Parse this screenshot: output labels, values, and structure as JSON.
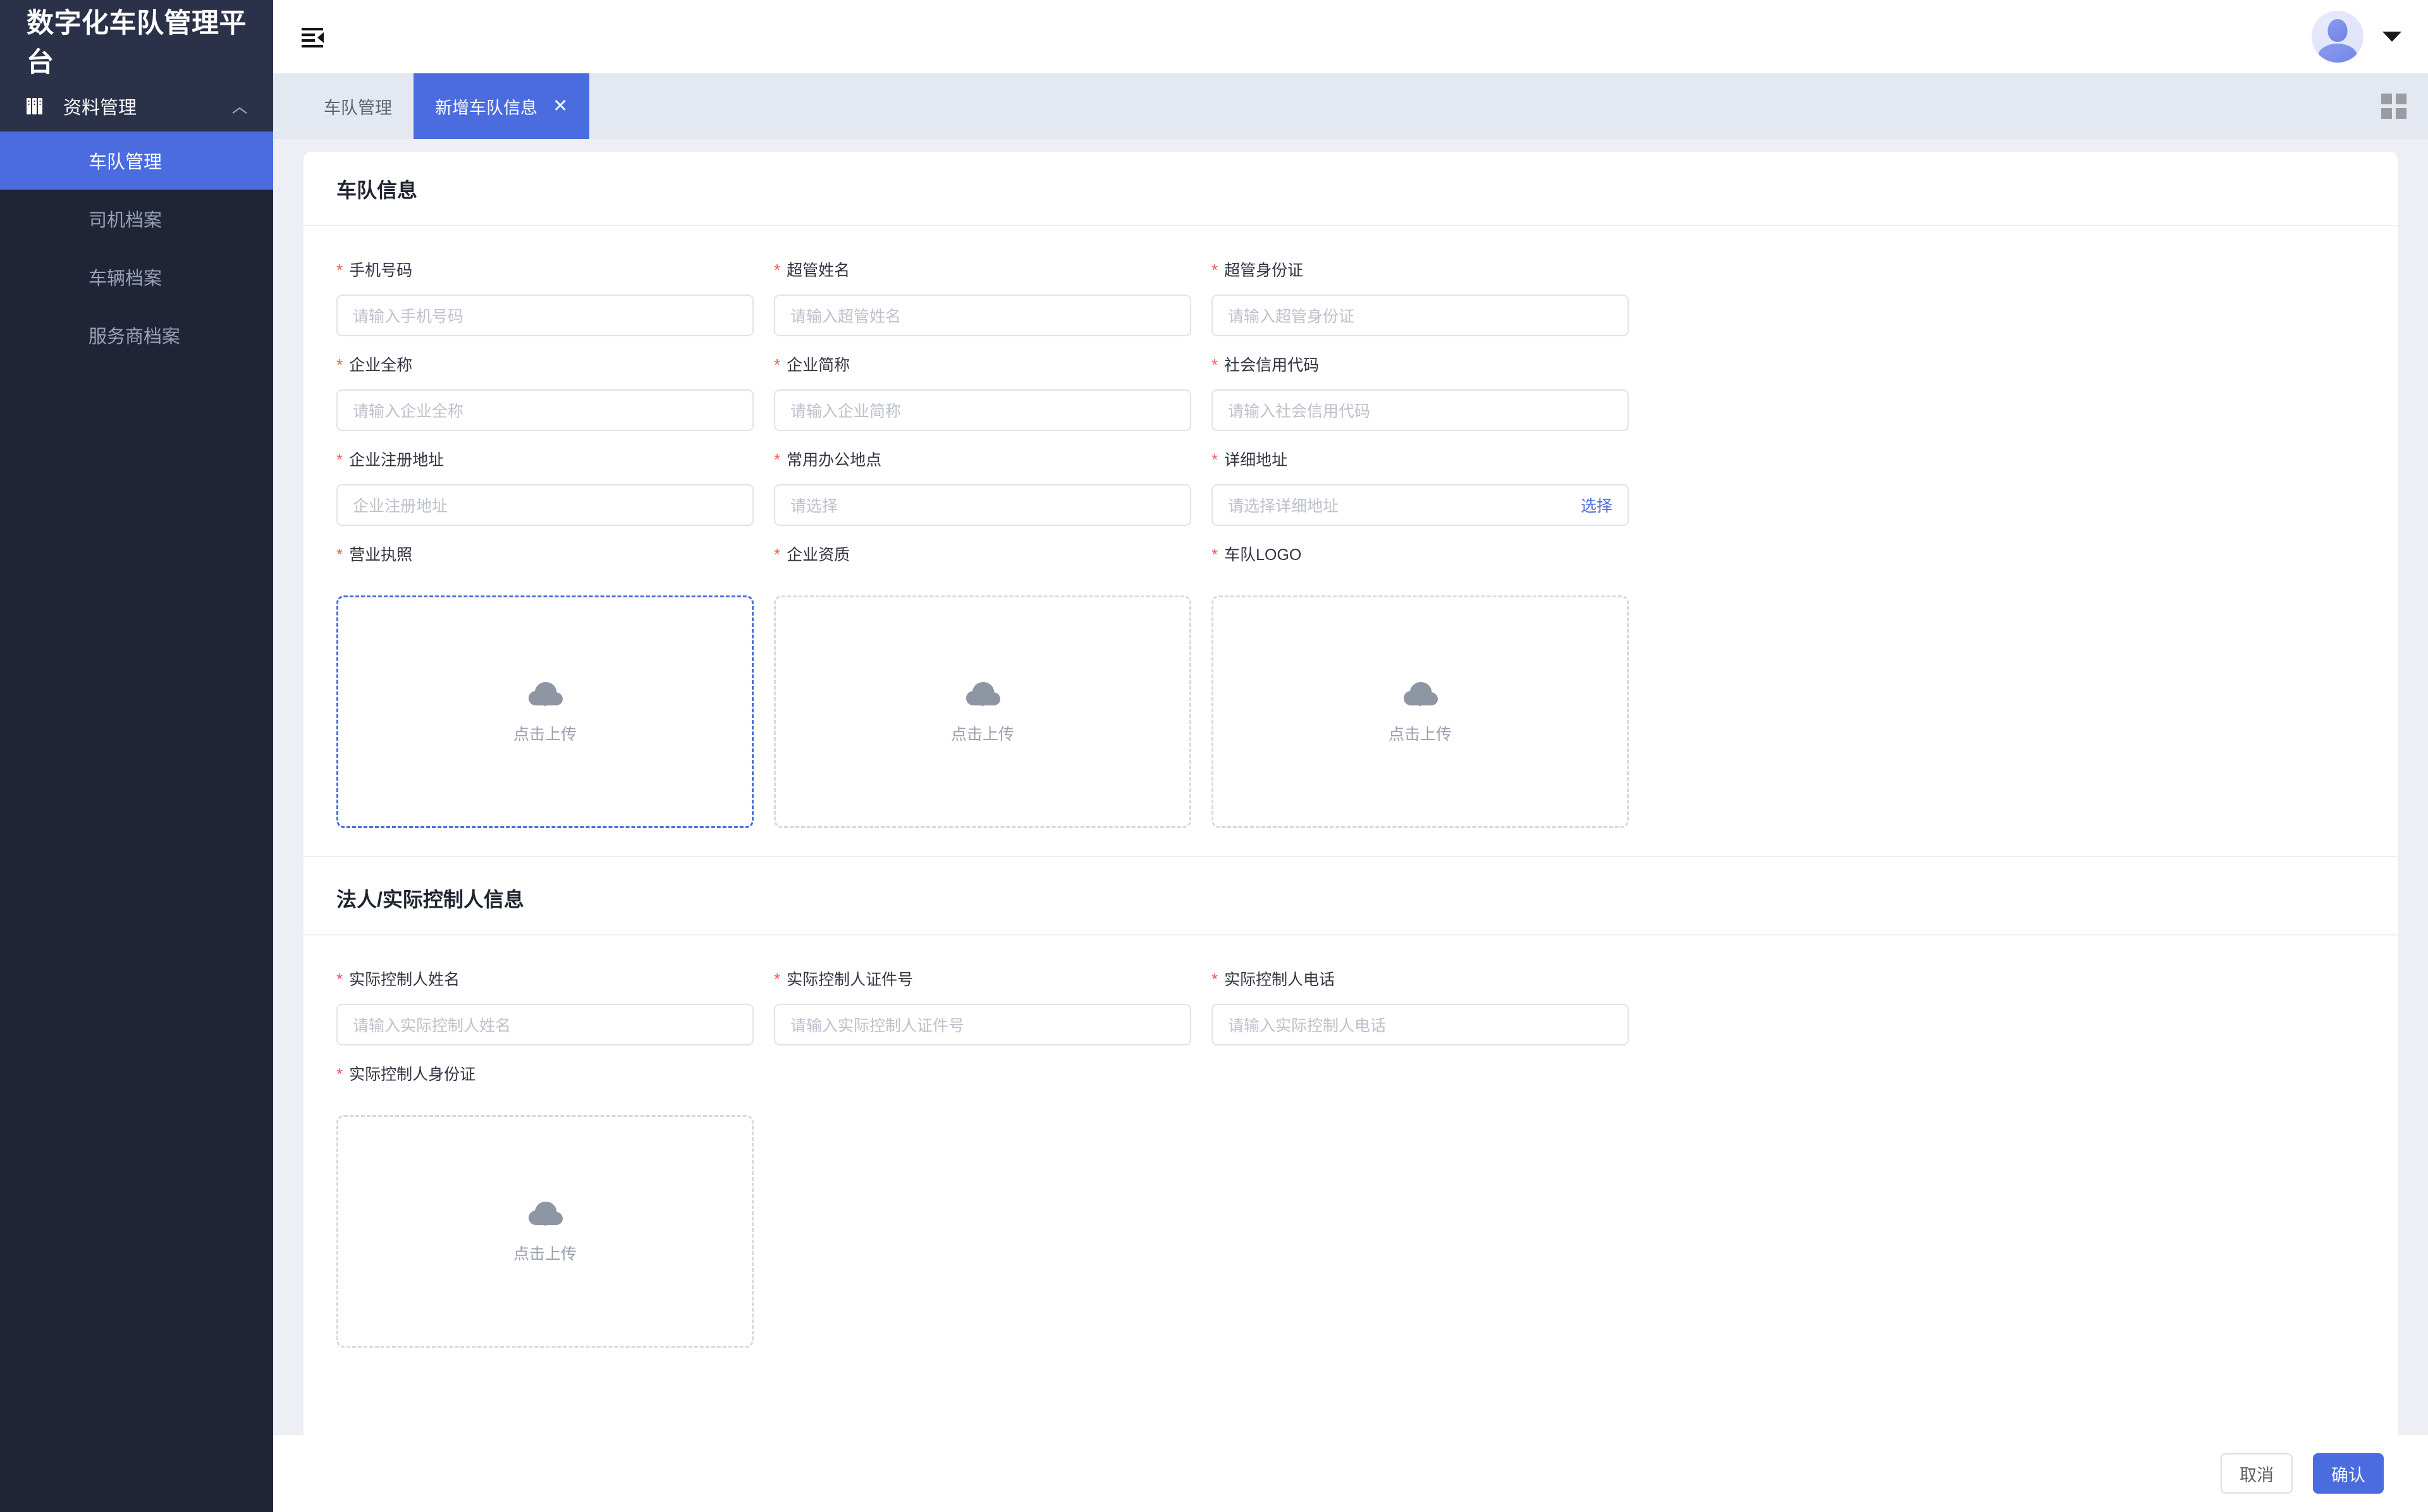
{
  "sidebar": {
    "brand_title": "数字化车队管理平台",
    "group": {
      "icon": "archive-books-icon",
      "label": "资料管理",
      "chevron": "chevron-up-icon"
    },
    "items": [
      {
        "label": "车队管理",
        "active": true
      },
      {
        "label": "司机档案",
        "active": false
      },
      {
        "label": "车辆档案",
        "active": false
      },
      {
        "label": "服务商档案",
        "active": false
      }
    ]
  },
  "topbar": {
    "fold_icon": "menu-fold-icon",
    "avatar": "user-avatar",
    "caret": "chevron-down-icon"
  },
  "tabbar": {
    "tabs": [
      {
        "label": "车队管理",
        "active": false,
        "closable": false
      },
      {
        "label": "新增车队信息",
        "active": true,
        "closable": true,
        "close_label": "✕"
      }
    ],
    "grid_icon": "grid-view-icon"
  },
  "sections": [
    {
      "title": "车队信息",
      "rows": [
        [
          {
            "label": "手机号码",
            "required": true,
            "placeholder": "请输入手机号码",
            "value": "",
            "type": "input"
          },
          {
            "label": "超管姓名",
            "required": true,
            "placeholder": "请输入超管姓名",
            "value": "",
            "type": "input"
          },
          {
            "label": "超管身份证",
            "required": true,
            "placeholder": "请输入超管身份证",
            "value": "",
            "type": "input"
          }
        ],
        [
          {
            "label": "企业全称",
            "required": true,
            "placeholder": "请输入企业全称",
            "value": "",
            "type": "input"
          },
          {
            "label": "企业简称",
            "required": true,
            "placeholder": "请输入企业简称",
            "value": "",
            "type": "input"
          },
          {
            "label": "社会信用代码",
            "required": true,
            "placeholder": "请输入社会信用代码",
            "value": "",
            "type": "input"
          }
        ],
        [
          {
            "label": "企业注册地址",
            "required": true,
            "placeholder": "企业注册地址",
            "value": "",
            "type": "input"
          },
          {
            "label": "常用办公地点",
            "required": true,
            "placeholder": "请选择",
            "value": "",
            "type": "select"
          },
          {
            "label": "详细地址",
            "required": true,
            "placeholder": "请选择详细地址",
            "value": "",
            "type": "input",
            "suffix": "选择"
          }
        ]
      ],
      "uploads": [
        {
          "label": "营业执照",
          "required": true,
          "text": "点击上传",
          "icon": "cloud-upload-icon",
          "active": true
        },
        {
          "label": "企业资质",
          "required": true,
          "text": "点击上传",
          "icon": "cloud-upload-icon",
          "active": false
        },
        {
          "label": "车队LOGO",
          "required": true,
          "text": "点击上传",
          "icon": "cloud-upload-icon",
          "active": false
        }
      ]
    },
    {
      "title": "法人/实际控制人信息",
      "rows": [
        [
          {
            "label": "实际控制人姓名",
            "required": true,
            "placeholder": "请输入实际控制人姓名",
            "value": "",
            "type": "input"
          },
          {
            "label": "实际控制人证件号",
            "required": true,
            "placeholder": "请输入实际控制人证件号",
            "value": "",
            "type": "input"
          },
          {
            "label": "实际控制人电话",
            "required": true,
            "placeholder": "请输入实际控制人电话",
            "value": "",
            "type": "input"
          }
        ]
      ],
      "uploads": [
        {
          "label": "实际控制人身份证",
          "required": true,
          "text": "点击上传",
          "icon": "cloud-upload-icon",
          "active": false
        }
      ]
    }
  ],
  "footer": {
    "cancel_label": "取消",
    "confirm_label": "确认"
  },
  "colors": {
    "accent": "#4a6cdf",
    "sidebar_bg": "#1f2437",
    "sidebar_group_bg": "#2b3149",
    "required_red": "#f05a5a",
    "page_bg": "#edeff5",
    "tabbar_bg": "#e4e8f0"
  }
}
